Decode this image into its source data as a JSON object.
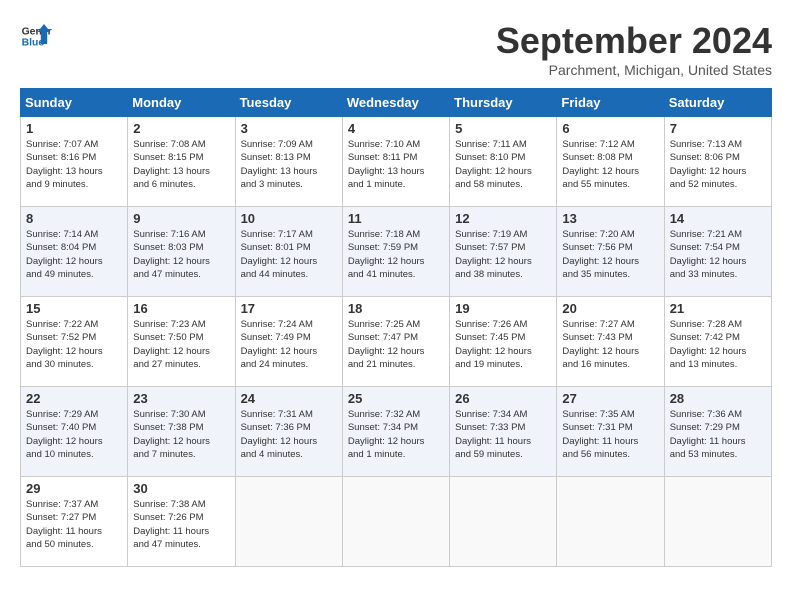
{
  "header": {
    "logo_line1": "General",
    "logo_line2": "Blue",
    "month_title": "September 2024",
    "subtitle": "Parchment, Michigan, United States"
  },
  "columns": [
    "Sunday",
    "Monday",
    "Tuesday",
    "Wednesday",
    "Thursday",
    "Friday",
    "Saturday"
  ],
  "weeks": [
    [
      {
        "day": "1",
        "info": "Sunrise: 7:07 AM\nSunset: 8:16 PM\nDaylight: 13 hours\nand 9 minutes."
      },
      {
        "day": "2",
        "info": "Sunrise: 7:08 AM\nSunset: 8:15 PM\nDaylight: 13 hours\nand 6 minutes."
      },
      {
        "day": "3",
        "info": "Sunrise: 7:09 AM\nSunset: 8:13 PM\nDaylight: 13 hours\nand 3 minutes."
      },
      {
        "day": "4",
        "info": "Sunrise: 7:10 AM\nSunset: 8:11 PM\nDaylight: 13 hours\nand 1 minute."
      },
      {
        "day": "5",
        "info": "Sunrise: 7:11 AM\nSunset: 8:10 PM\nDaylight: 12 hours\nand 58 minutes."
      },
      {
        "day": "6",
        "info": "Sunrise: 7:12 AM\nSunset: 8:08 PM\nDaylight: 12 hours\nand 55 minutes."
      },
      {
        "day": "7",
        "info": "Sunrise: 7:13 AM\nSunset: 8:06 PM\nDaylight: 12 hours\nand 52 minutes."
      }
    ],
    [
      {
        "day": "8",
        "info": "Sunrise: 7:14 AM\nSunset: 8:04 PM\nDaylight: 12 hours\nand 49 minutes."
      },
      {
        "day": "9",
        "info": "Sunrise: 7:16 AM\nSunset: 8:03 PM\nDaylight: 12 hours\nand 47 minutes."
      },
      {
        "day": "10",
        "info": "Sunrise: 7:17 AM\nSunset: 8:01 PM\nDaylight: 12 hours\nand 44 minutes."
      },
      {
        "day": "11",
        "info": "Sunrise: 7:18 AM\nSunset: 7:59 PM\nDaylight: 12 hours\nand 41 minutes."
      },
      {
        "day": "12",
        "info": "Sunrise: 7:19 AM\nSunset: 7:57 PM\nDaylight: 12 hours\nand 38 minutes."
      },
      {
        "day": "13",
        "info": "Sunrise: 7:20 AM\nSunset: 7:56 PM\nDaylight: 12 hours\nand 35 minutes."
      },
      {
        "day": "14",
        "info": "Sunrise: 7:21 AM\nSunset: 7:54 PM\nDaylight: 12 hours\nand 33 minutes."
      }
    ],
    [
      {
        "day": "15",
        "info": "Sunrise: 7:22 AM\nSunset: 7:52 PM\nDaylight: 12 hours\nand 30 minutes."
      },
      {
        "day": "16",
        "info": "Sunrise: 7:23 AM\nSunset: 7:50 PM\nDaylight: 12 hours\nand 27 minutes."
      },
      {
        "day": "17",
        "info": "Sunrise: 7:24 AM\nSunset: 7:49 PM\nDaylight: 12 hours\nand 24 minutes."
      },
      {
        "day": "18",
        "info": "Sunrise: 7:25 AM\nSunset: 7:47 PM\nDaylight: 12 hours\nand 21 minutes."
      },
      {
        "day": "19",
        "info": "Sunrise: 7:26 AM\nSunset: 7:45 PM\nDaylight: 12 hours\nand 19 minutes."
      },
      {
        "day": "20",
        "info": "Sunrise: 7:27 AM\nSunset: 7:43 PM\nDaylight: 12 hours\nand 16 minutes."
      },
      {
        "day": "21",
        "info": "Sunrise: 7:28 AM\nSunset: 7:42 PM\nDaylight: 12 hours\nand 13 minutes."
      }
    ],
    [
      {
        "day": "22",
        "info": "Sunrise: 7:29 AM\nSunset: 7:40 PM\nDaylight: 12 hours\nand 10 minutes."
      },
      {
        "day": "23",
        "info": "Sunrise: 7:30 AM\nSunset: 7:38 PM\nDaylight: 12 hours\nand 7 minutes."
      },
      {
        "day": "24",
        "info": "Sunrise: 7:31 AM\nSunset: 7:36 PM\nDaylight: 12 hours\nand 4 minutes."
      },
      {
        "day": "25",
        "info": "Sunrise: 7:32 AM\nSunset: 7:34 PM\nDaylight: 12 hours\nand 1 minute."
      },
      {
        "day": "26",
        "info": "Sunrise: 7:34 AM\nSunset: 7:33 PM\nDaylight: 11 hours\nand 59 minutes."
      },
      {
        "day": "27",
        "info": "Sunrise: 7:35 AM\nSunset: 7:31 PM\nDaylight: 11 hours\nand 56 minutes."
      },
      {
        "day": "28",
        "info": "Sunrise: 7:36 AM\nSunset: 7:29 PM\nDaylight: 11 hours\nand 53 minutes."
      }
    ],
    [
      {
        "day": "29",
        "info": "Sunrise: 7:37 AM\nSunset: 7:27 PM\nDaylight: 11 hours\nand 50 minutes."
      },
      {
        "day": "30",
        "info": "Sunrise: 7:38 AM\nSunset: 7:26 PM\nDaylight: 11 hours\nand 47 minutes."
      },
      {
        "day": "",
        "info": ""
      },
      {
        "day": "",
        "info": ""
      },
      {
        "day": "",
        "info": ""
      },
      {
        "day": "",
        "info": ""
      },
      {
        "day": "",
        "info": ""
      }
    ]
  ]
}
